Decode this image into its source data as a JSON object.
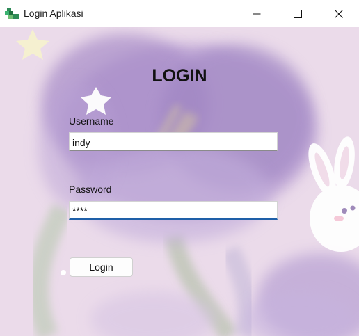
{
  "window": {
    "title": "Login Aplikasi",
    "controls": [
      "minimize-icon",
      "maximize-icon",
      "close-icon"
    ]
  },
  "form": {
    "heading": "LOGIN",
    "username_label": "Username",
    "username_value": "indy",
    "password_label": "Password",
    "password_value": "****",
    "login_button": "Login"
  },
  "colors": {
    "background": "#ebdbea",
    "tulip": "#a98fc9",
    "focus_underline": "#1e5fa8"
  }
}
